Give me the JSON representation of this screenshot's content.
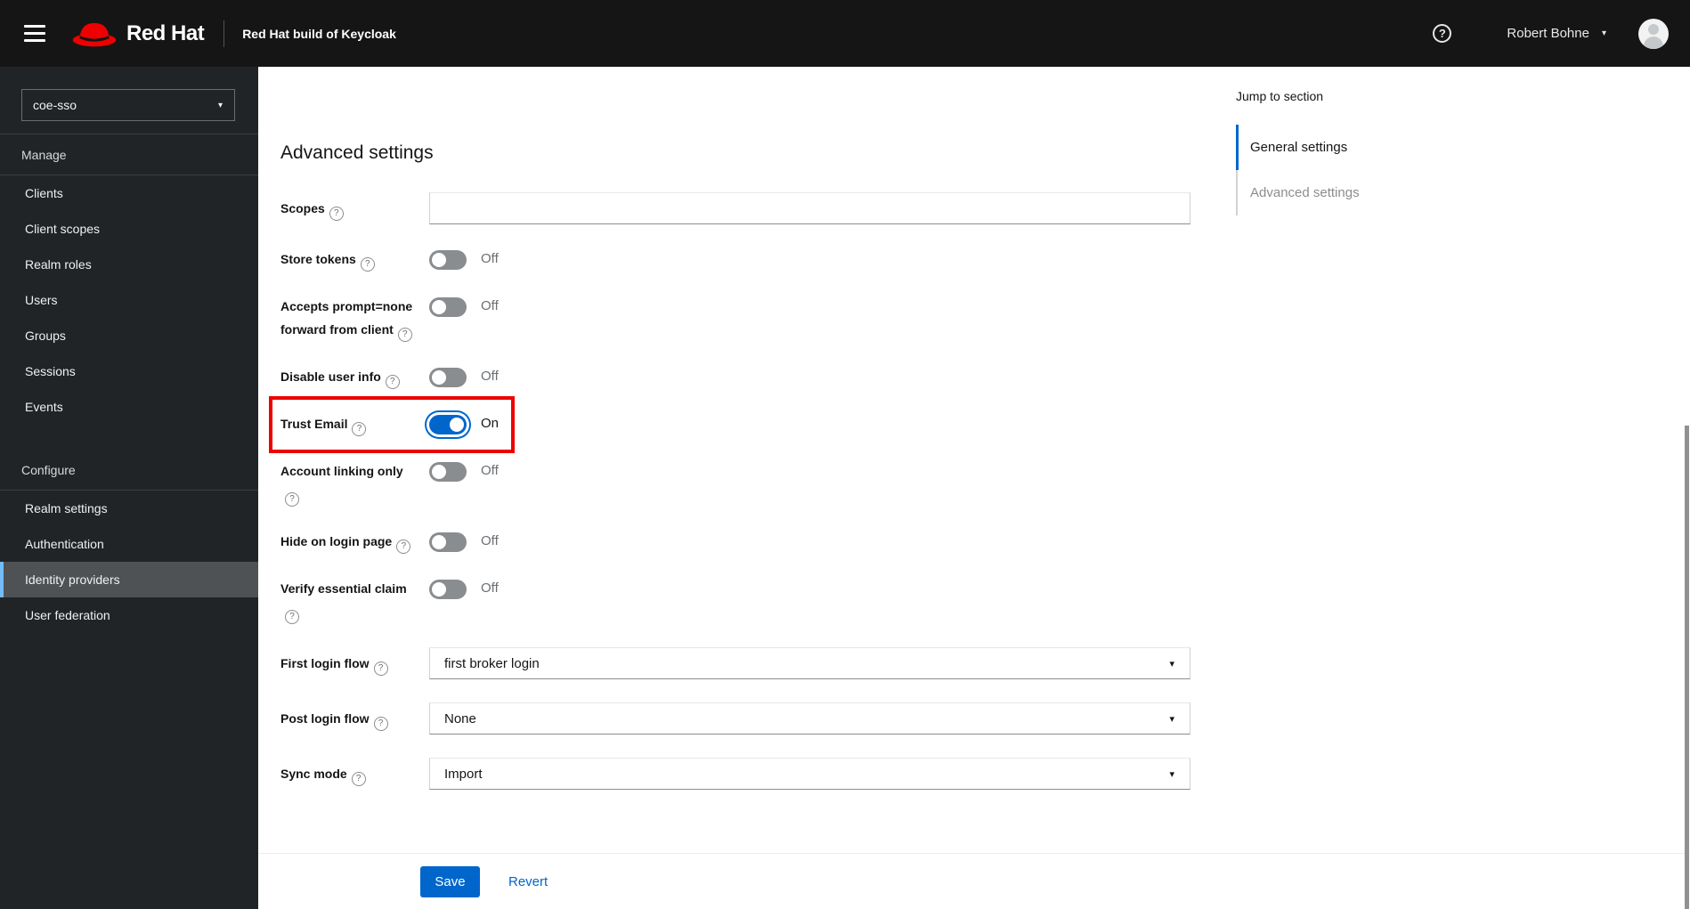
{
  "header": {
    "logo_text": "Red Hat",
    "product_title": "Red Hat build of Keycloak",
    "user_name": "Robert Bohne"
  },
  "icons": {
    "question_glyph": "?",
    "caret_down_glyph": "▾"
  },
  "sidebar": {
    "realm": "coe-sso",
    "groups": [
      {
        "label": "Manage",
        "items": [
          "Clients",
          "Client scopes",
          "Realm roles",
          "Users",
          "Groups",
          "Sessions",
          "Events"
        ]
      },
      {
        "label": "Configure",
        "items": [
          "Realm settings",
          "Authentication",
          "Identity providers",
          "User federation"
        ]
      }
    ],
    "active_item": "Identity providers"
  },
  "main": {
    "heading": "Advanced settings",
    "fields": [
      {
        "label": "Scopes",
        "type": "text",
        "value": "",
        "help": true
      },
      {
        "label": "Store tokens",
        "type": "switch",
        "state": "Off",
        "on": false,
        "help": true
      },
      {
        "label": "Accepts prompt=none forward from client",
        "type": "switch",
        "state": "Off",
        "on": false,
        "help": true
      },
      {
        "label": "Disable user info",
        "type": "switch",
        "state": "Off",
        "on": false,
        "help": true
      },
      {
        "label": "Trust Email",
        "type": "switch",
        "state": "On",
        "on": true,
        "help": true,
        "highlighted": true
      },
      {
        "label": "Account linking only",
        "type": "switch",
        "state": "Off",
        "on": false,
        "help": true
      },
      {
        "label": "Hide on login page",
        "type": "switch",
        "state": "Off",
        "on": false,
        "help": true
      },
      {
        "label": "Verify essential claim",
        "type": "switch",
        "state": "Off",
        "on": false,
        "help": true
      },
      {
        "label": "First login flow",
        "type": "select",
        "value": "first broker login",
        "help": true
      },
      {
        "label": "Post login flow",
        "type": "select",
        "value": "None",
        "help": true
      },
      {
        "label": "Sync mode",
        "type": "select",
        "value": "Import",
        "help": true
      }
    ],
    "actions": {
      "save": "Save",
      "revert": "Revert"
    }
  },
  "jump_panel": {
    "title": "Jump to section",
    "items": [
      {
        "label": "General settings",
        "active": true
      },
      {
        "label": "Advanced settings",
        "active": false
      }
    ]
  },
  "colors": {
    "header_bg": "#151515",
    "sidebar_bg": "#212427",
    "nav_active_bg": "#4f5255",
    "nav_active_accent": "#73bcf7",
    "primary_blue": "#0066cc",
    "switch_off": "#8a8d90",
    "annotation_red": "#ec0000",
    "logo_red": "#ee0000"
  }
}
